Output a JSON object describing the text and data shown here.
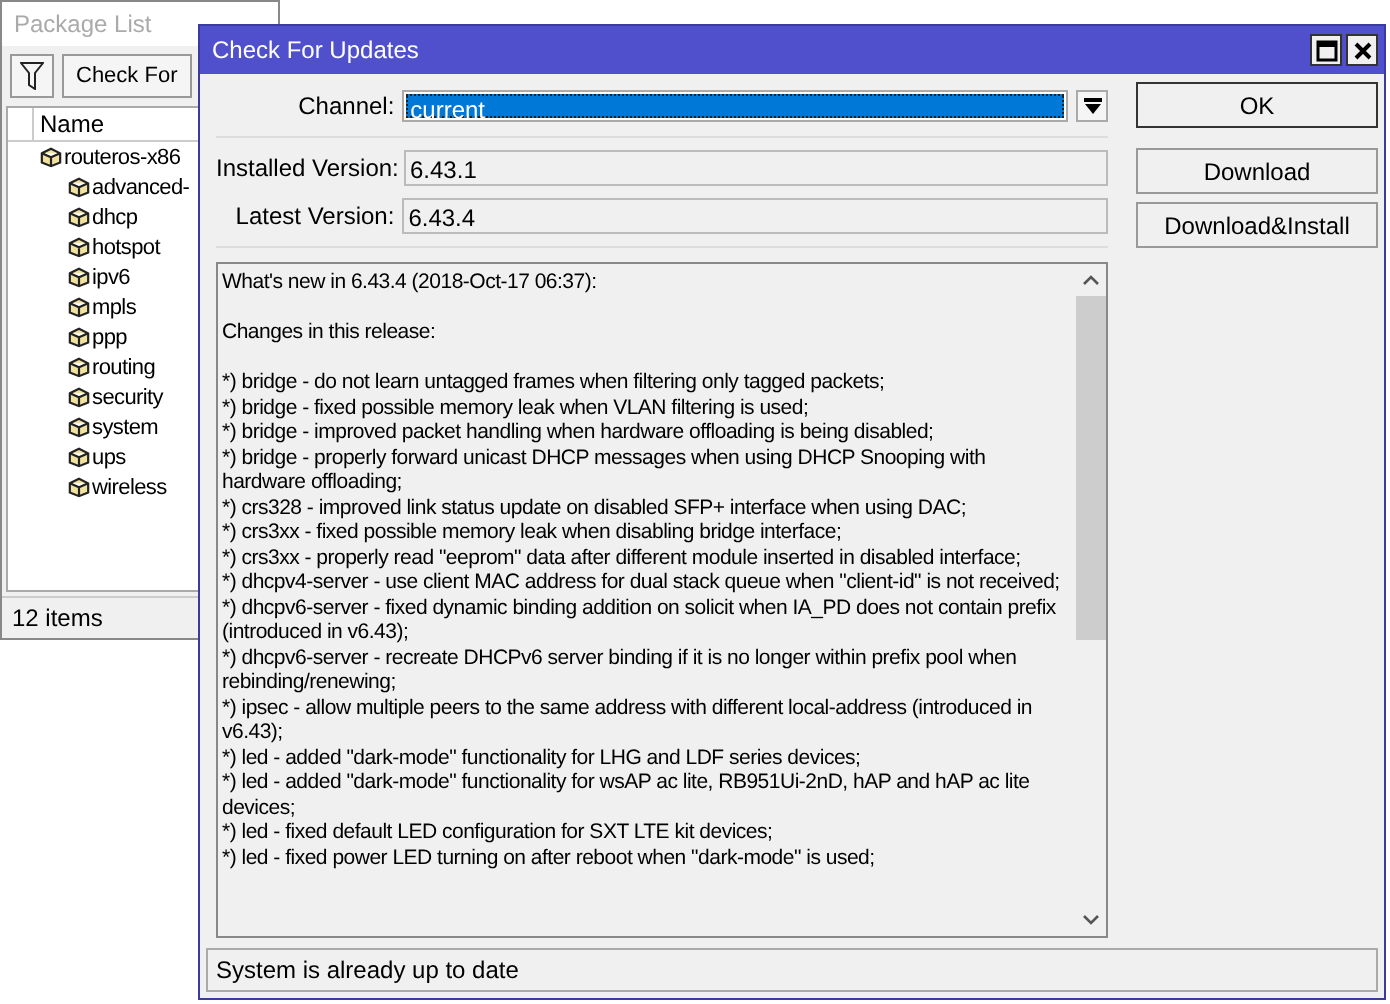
{
  "package_list": {
    "title": "Package List",
    "toolbar": {
      "button": "Check For"
    },
    "columns": [
      "Name"
    ],
    "tree": [
      {
        "name": "routeros-x86",
        "children": [
          {
            "name": "advanced-"
          },
          {
            "name": "dhcp"
          },
          {
            "name": "hotspot"
          },
          {
            "name": "ipv6"
          },
          {
            "name": "mpls"
          },
          {
            "name": "ppp"
          },
          {
            "name": "routing"
          },
          {
            "name": "security"
          },
          {
            "name": "system"
          },
          {
            "name": "ups"
          },
          {
            "name": "wireless"
          }
        ]
      }
    ],
    "status_bar": "12 items"
  },
  "dialog": {
    "title": "Check For Updates",
    "channel": {
      "label": "Channel:",
      "value": "current"
    },
    "installed_version": {
      "label": "Installed Version:",
      "value": "6.43.1"
    },
    "latest_version": {
      "label": "Latest Version:",
      "value": "6.43.4"
    },
    "buttons": [
      "OK",
      "Download",
      "Download&Install"
    ],
    "changelog": {
      "title": "What's new in 6.43.4 (2018-Oct-17 06:37):",
      "subtitle": "Changes in this release:",
      "items": [
        "*) bridge - do not learn untagged frames when filtering only tagged packets;",
        "*) bridge - fixed possible memory leak when VLAN filtering is used;",
        "*) bridge - improved packet handling when hardware offloading is being disabled;",
        "*) bridge - properly forward unicast DHCP messages when using DHCP Snooping with hardware offloading;",
        "*) crs328 - improved link status update on disabled SFP+ interface when using DAC;",
        "*) crs3xx - fixed possible memory leak when disabling bridge interface;",
        "*) crs3xx - properly read \"eeprom\" data after different module inserted in disabled interface;",
        "*) dhcpv4-server - use client MAC address for dual stack queue when \"client-id\" is not received;",
        "*) dhcpv6-server - fixed dynamic binding addition on solicit when IA_PD does not contain prefix (introduced in v6.43);",
        "*) dhcpv6-server - recreate DHCPv6 server binding if it is no longer within prefix pool when rebinding/renewing;",
        "*) ipsec - allow multiple peers to the same address with different local-address (introduced in v6.43);",
        "*) led - added \"dark-mode\" functionality for LHG and LDF series devices;",
        "*) led - added \"dark-mode\" functionality for wsAP ac lite, RB951Ui-2nD, hAP and hAP ac lite devices;",
        "*) led - fixed default LED configuration for SXT LTE kit devices;",
        "*) led - fixed power LED turning on after reboot when \"dark-mode\" is used;"
      ]
    },
    "status_bar": "System is already up to date"
  }
}
